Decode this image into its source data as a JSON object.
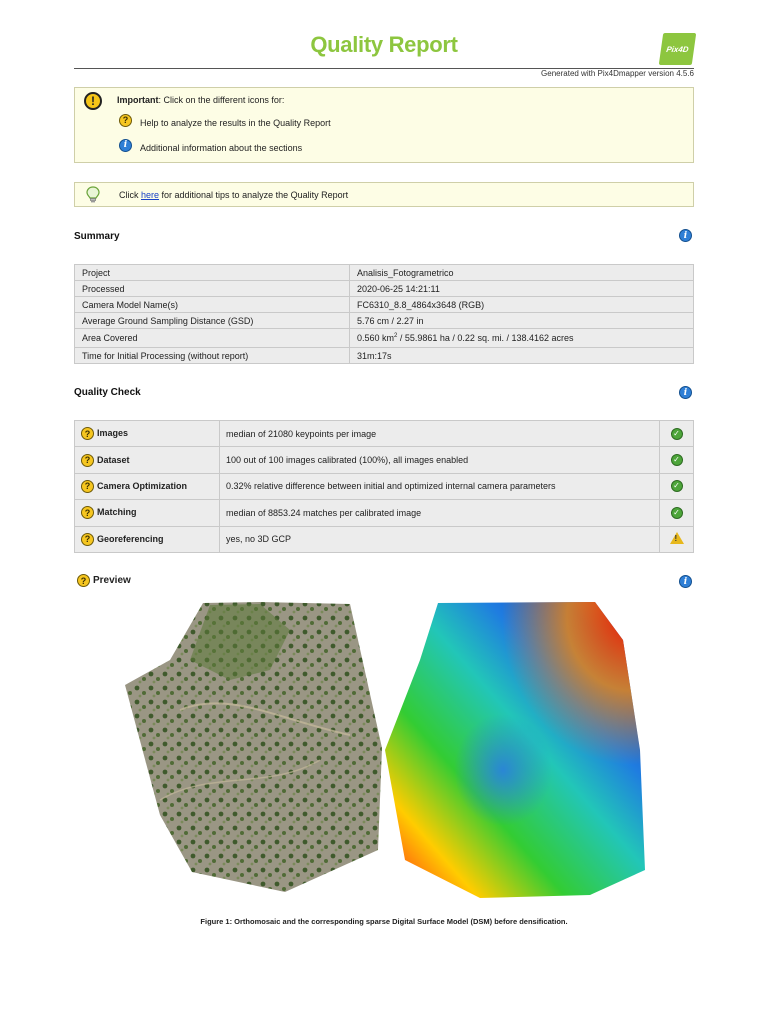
{
  "header": {
    "title": "Quality Report",
    "logo_text": "Pix4D",
    "generated": "Generated with Pix4Dmapper version 4.5.6"
  },
  "important": {
    "label": "Important",
    "text": ": Click on the different icons for:",
    "help": "Help to analyze the results in the Quality Report",
    "info": "Additional information about the sections"
  },
  "tips": {
    "prefix": "Click ",
    "link": "here",
    "suffix": " for additional tips to analyze the Quality Report"
  },
  "summary": {
    "title": "Summary",
    "rows": [
      {
        "label": "Project",
        "value": "Analisis_Fotogrametrico"
      },
      {
        "label": "Processed",
        "value": "2020-06-25 14:21:11"
      },
      {
        "label": "Camera Model Name(s)",
        "value": "FC6310_8.8_4864x3648 (RGB)"
      },
      {
        "label": "Average Ground Sampling Distance (GSD)",
        "value": "5.76 cm / 2.27 in"
      },
      {
        "label": "Area Covered",
        "value_a": "0.560 km",
        "value_sup": "2",
        "value_b": " / 55.9861 ha / 0.22 sq. mi. / 138.4162 acres"
      },
      {
        "label": "Time for Initial Processing (without report)",
        "value": "31m:17s"
      }
    ]
  },
  "quality": {
    "title": "Quality Check",
    "rows": [
      {
        "label": "Images",
        "value": "median of 21080 keypoints per image",
        "status": "ok"
      },
      {
        "label": "Dataset",
        "value": "100 out of 100 images calibrated (100%), all images enabled",
        "status": "ok"
      },
      {
        "label": "Camera Optimization",
        "value": "0.32% relative difference between initial and optimized internal camera parameters",
        "status": "ok"
      },
      {
        "label": "Matching",
        "value": "median of 8853.24 matches per calibrated image",
        "status": "ok"
      },
      {
        "label": "Georeferencing",
        "value": "yes, no 3D GCP",
        "status": "warning"
      }
    ]
  },
  "preview": {
    "title": "Preview",
    "caption": "Figure 1: Orthomosaic and the corresponding sparse Digital Surface Model (DSM) before densification."
  },
  "colors": {
    "accent": "#8dc63f",
    "box_bg": "#fdfde5",
    "table_bg": "#ececec",
    "link": "#1a43c7"
  }
}
